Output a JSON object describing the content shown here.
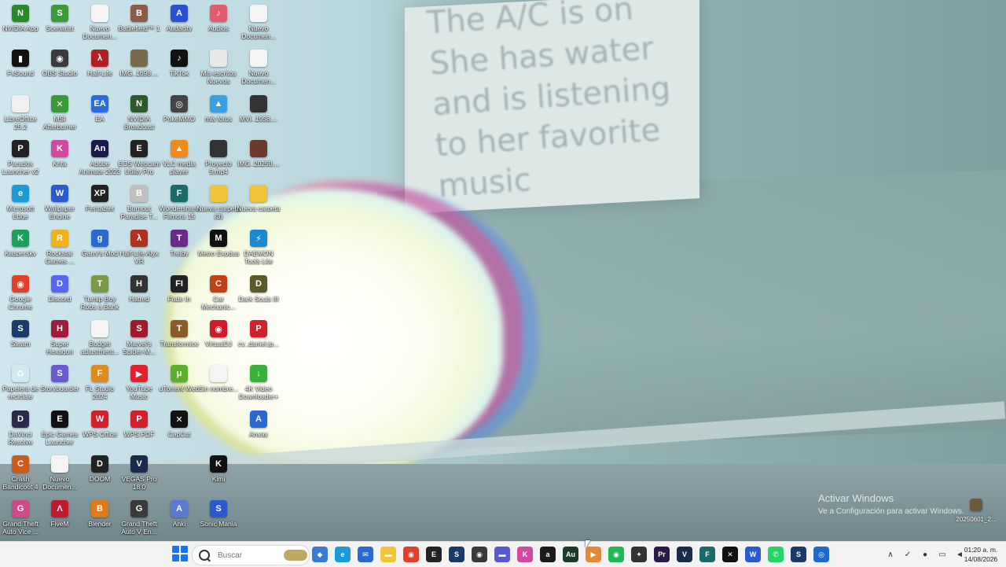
{
  "desktop": {
    "icons": [
      {
        "label": "NVIDIA App",
        "icon": "nvidia-icon",
        "color": "#2a8a2a",
        "glyph": "N"
      },
      {
        "label": "Scenarist",
        "icon": "scenarist-icon",
        "color": "#3c9a3c",
        "glyph": "S"
      },
      {
        "label": "Nuevo Documen...",
        "icon": "document-icon",
        "color": "#f4f4f4",
        "glyph": ""
      },
      {
        "label": "Battlefield™ 1",
        "icon": "battlefield-icon",
        "color": "#8a5a4a",
        "glyph": "B"
      },
      {
        "label": "Audacity",
        "icon": "audacity-icon",
        "color": "#2b4fd1",
        "glyph": "A"
      },
      {
        "label": "Audios",
        "icon": "music-icon",
        "color": "#e25c6f",
        "glyph": "♪"
      },
      {
        "label": "Nuevo Documen...",
        "icon": "document-icon",
        "color": "#f4f4f4",
        "glyph": ""
      },
      {
        "label": "FxSound",
        "icon": "fxsound-icon",
        "color": "#111111",
        "glyph": "▮"
      },
      {
        "label": "OBS Studio",
        "icon": "obs-icon",
        "color": "#3a3a3a",
        "glyph": "◉"
      },
      {
        "label": "Half-Life",
        "icon": "half-life-icon",
        "color": "#b02020",
        "glyph": "λ"
      },
      {
        "label": "IMG_1698....",
        "icon": "image-icon",
        "color": "#7a6a4a",
        "glyph": ""
      },
      {
        "label": "TikTok",
        "icon": "tiktok-icon",
        "color": "#111111",
        "glyph": "♪"
      },
      {
        "label": "Mis escritos Nuevos",
        "icon": "documents-icon",
        "color": "#e8e8e8",
        "glyph": ""
      },
      {
        "label": "Nuevo Documen...",
        "icon": "document-icon",
        "color": "#f4f4f4",
        "glyph": ""
      },
      {
        "label": "LibreOffice 25.2",
        "icon": "libreoffice-icon",
        "color": "#f0f0f0",
        "glyph": ""
      },
      {
        "label": "MSI Afterburner",
        "icon": "msi-icon",
        "color": "#3a9a3a",
        "glyph": "✕"
      },
      {
        "label": "EA",
        "icon": "ea-icon",
        "color": "#2b6be0",
        "glyph": "EA"
      },
      {
        "label": "NVIDIA Broadcast",
        "icon": "nvidia-broadcast-icon",
        "color": "#2a5a2a",
        "glyph": "N"
      },
      {
        "label": "PokeMMO",
        "icon": "pokemmo-icon",
        "color": "#444444",
        "glyph": "◎"
      },
      {
        "label": "mis fotos",
        "icon": "photos-icon",
        "color": "#3aa0e0",
        "glyph": "▲"
      },
      {
        "label": "MVI_1958....",
        "icon": "video-icon",
        "color": "#333333",
        "glyph": ""
      },
      {
        "label": "Paradox Launcher v2",
        "icon": "paradox-icon",
        "color": "#222222",
        "glyph": "P"
      },
      {
        "label": "Krita",
        "icon": "krita-icon",
        "color": "#d04aa0",
        "glyph": "K"
      },
      {
        "label": "Adobe Animate 2023",
        "icon": "animate-icon",
        "color": "#1a1a4a",
        "glyph": "An"
      },
      {
        "label": "EOS Webcam Utility Pro",
        "icon": "eos-icon",
        "color": "#222222",
        "glyph": "E"
      },
      {
        "label": "VLC media player",
        "icon": "vlc-icon",
        "color": "#f08a1a",
        "glyph": "▲"
      },
      {
        "label": "Proyecto 9.mp4",
        "icon": "video-icon",
        "color": "#333333",
        "glyph": ""
      },
      {
        "label": "IMG_20250....",
        "icon": "image-icon",
        "color": "#6a3a2a",
        "glyph": ""
      },
      {
        "label": "Microsoft Edge",
        "icon": "edge-icon",
        "color": "#1a9ad6",
        "glyph": "e"
      },
      {
        "label": "Wallpaper Engine",
        "icon": "wallpaper-engine-icon",
        "color": "#2a5ad0",
        "glyph": "W"
      },
      {
        "label": "Pentablet",
        "icon": "pentablet-icon",
        "color": "#222222",
        "glyph": "XP"
      },
      {
        "label": "Burnout Paradise T...",
        "icon": "burnout-icon",
        "color": "#c0c0c0",
        "glyph": "B"
      },
      {
        "label": "Wondershare Filmora 15",
        "icon": "filmora-icon",
        "color": "#1a6a6a",
        "glyph": "F"
      },
      {
        "label": "Nueva carpeta (3)",
        "icon": "folder-icon",
        "color": "#f2c43a",
        "glyph": ""
      },
      {
        "label": "Nueva carpeta",
        "icon": "folder-icon",
        "color": "#f2c43a",
        "glyph": ""
      },
      {
        "label": "Kaspersky",
        "icon": "kaspersky-icon",
        "color": "#1aa05a",
        "glyph": "K"
      },
      {
        "label": "Rockstar Games ...",
        "icon": "rockstar-icon",
        "color": "#f2b01a",
        "glyph": "R"
      },
      {
        "label": "Garry's Mod",
        "icon": "garrys-mod-icon",
        "color": "#2a6ad0",
        "glyph": "g"
      },
      {
        "label": "Half-Life Alyx VR",
        "icon": "alyx-icon",
        "color": "#b03020",
        "glyph": "λ"
      },
      {
        "label": "Trelby",
        "icon": "trelby-icon",
        "color": "#6a2a8a",
        "glyph": "T"
      },
      {
        "label": "Metro Exodus",
        "icon": "metro-icon",
        "color": "#111111",
        "glyph": "M"
      },
      {
        "label": "DAEMON Tools Lite",
        "icon": "daemon-tools-icon",
        "color": "#1a8ad0",
        "glyph": "⚡"
      },
      {
        "label": "Google Chrome",
        "icon": "chrome-icon",
        "color": "#e0402a",
        "glyph": "◉"
      },
      {
        "label": "Discord",
        "icon": "discord-icon",
        "color": "#5865f2",
        "glyph": "D"
      },
      {
        "label": "Turnip Boy Robs a Bank",
        "icon": "turnip-icon",
        "color": "#7a9a4a",
        "glyph": "T"
      },
      {
        "label": "Hatred",
        "icon": "hatred-icon",
        "color": "#333333",
        "glyph": "H"
      },
      {
        "label": "Fade In",
        "icon": "fadein-icon",
        "color": "#222222",
        "glyph": "FI"
      },
      {
        "label": "Car Mechanic...",
        "icon": "car-mechanic-icon",
        "color": "#c0401a",
        "glyph": "C"
      },
      {
        "label": "Dark Souls III",
        "icon": "dark-souls-icon",
        "color": "#5a5a2a",
        "glyph": "D"
      },
      {
        "label": "Steam",
        "icon": "steam-icon",
        "color": "#1a3a6a",
        "glyph": "S"
      },
      {
        "label": "Super Hexagon",
        "icon": "super-hexagon-icon",
        "color": "#a01a3a",
        "glyph": "H"
      },
      {
        "label": "Budget adjustment...",
        "icon": "document-icon",
        "color": "#f4f4f4",
        "glyph": ""
      },
      {
        "label": "Marvel's Spider-M...",
        "icon": "spiderman-icon",
        "color": "#a01a2a",
        "glyph": "S"
      },
      {
        "label": "Transformice",
        "icon": "transformice-icon",
        "color": "#8a5a2a",
        "glyph": "T"
      },
      {
        "label": "VirtualDJ",
        "icon": "virtualdj-icon",
        "color": "#d01a2a",
        "glyph": "◉"
      },
      {
        "label": "cv_daniel.jp...",
        "icon": "wps-pdf-icon",
        "color": "#d0202a",
        "glyph": "P"
      },
      {
        "label": "Papelera de reciclaje",
        "icon": "recycle-bin-icon",
        "color": "#d0e8f0",
        "glyph": "♻"
      },
      {
        "label": "Storyboarder",
        "icon": "storyboarder-icon",
        "color": "#6a5ad0",
        "glyph": "S"
      },
      {
        "label": "FL Studio 2024",
        "icon": "fl-studio-icon",
        "color": "#e08a1a",
        "glyph": "F"
      },
      {
        "label": "YouTube Music",
        "icon": "youtube-music-icon",
        "color": "#e0202a",
        "glyph": "▶"
      },
      {
        "label": "uTorrent Web",
        "icon": "utorrent-icon",
        "color": "#5ab02a",
        "glyph": "μ"
      },
      {
        "label": "Sin nombre...",
        "icon": "document-icon",
        "color": "#f4f4f4",
        "glyph": ""
      },
      {
        "label": "4K Video Downloader+",
        "icon": "4k-video-icon",
        "color": "#3ab03a",
        "glyph": "↓"
      },
      {
        "label": "DaVinci Resolve",
        "icon": "davinci-icon",
        "color": "#2a2a4a",
        "glyph": "D"
      },
      {
        "label": "Epic Games Launcher",
        "icon": "epic-games-icon",
        "color": "#111111",
        "glyph": "E"
      },
      {
        "label": "WPS Office",
        "icon": "wps-office-icon",
        "color": "#d0202a",
        "glyph": "W"
      },
      {
        "label": "WPS PDF",
        "icon": "wps-pdf-icon",
        "color": "#d0202a",
        "glyph": "P"
      },
      {
        "label": "CapCut",
        "icon": "capcut-icon",
        "color": "#111111",
        "glyph": "✕"
      },
      {
        "label": "",
        "icon": "",
        "color": "",
        "glyph": ""
      },
      {
        "label": "Anvay",
        "icon": "anvay-icon",
        "color": "#2a6ad0",
        "glyph": "A"
      },
      {
        "label": "Crash Bandicoot 4",
        "icon": "crash-icon",
        "color": "#d05a1a",
        "glyph": "C"
      },
      {
        "label": "Nuevo Documen...",
        "icon": "document-icon",
        "color": "#f4f4f4",
        "glyph": ""
      },
      {
        "label": "DOOM",
        "icon": "doom-icon",
        "color": "#222222",
        "glyph": "D"
      },
      {
        "label": "VEGAS Pro 18.0",
        "icon": "vegas-icon",
        "color": "#1a2a4a",
        "glyph": "V"
      },
      {
        "label": "",
        "icon": "",
        "color": "",
        "glyph": ""
      },
      {
        "label": "Kimi",
        "icon": "kimi-icon",
        "color": "#111111",
        "glyph": "K"
      },
      {
        "label": "",
        "icon": "",
        "color": "",
        "glyph": ""
      },
      {
        "label": "Grand Theft Auto Vice ...",
        "icon": "gta-vice-icon",
        "color": "#d04a8a",
        "glyph": "G"
      },
      {
        "label": "FiveM",
        "icon": "fivem-icon",
        "color": "#c01a2a",
        "glyph": "Λ"
      },
      {
        "label": "Blender",
        "icon": "blender-icon",
        "color": "#e07a1a",
        "glyph": "B"
      },
      {
        "label": "Grand Theft Auto V En...",
        "icon": "gta-v-icon",
        "color": "#3a3a3a",
        "glyph": "G"
      },
      {
        "label": "Anki",
        "icon": "anki-icon",
        "color": "#5a7ad0",
        "glyph": "A"
      },
      {
        "label": "Sonic Mania",
        "icon": "sonic-icon",
        "color": "#2a5ad0",
        "glyph": "S"
      },
      {
        "label": "",
        "icon": "",
        "color": "",
        "glyph": ""
      }
    ],
    "wallpaper_sign_text": "The A/C is on\nShe has water\nand is listening\nto her favorite\nmusic",
    "watermark": {
      "line1": "Activar Windows",
      "line2": "Ve a Configuración para activar Windows."
    },
    "corner_file": {
      "label": "20250601_2...",
      "icon": "image-icon"
    }
  },
  "taskbar": {
    "search_placeholder": "Buscar",
    "apps": [
      {
        "icon": "copilot-icon",
        "color": "#3a7ad0",
        "glyph": "◆"
      },
      {
        "icon": "edge-icon",
        "color": "#1a9ad6",
        "glyph": "e"
      },
      {
        "icon": "mail-icon",
        "color": "#2a6ad0",
        "glyph": "✉"
      },
      {
        "icon": "file-explorer-icon",
        "color": "#f2c43a",
        "glyph": "▬"
      },
      {
        "icon": "chrome-icon",
        "color": "#e0402a",
        "glyph": "◉"
      },
      {
        "icon": "epic-games-icon",
        "color": "#222222",
        "glyph": "E"
      },
      {
        "icon": "steam-icon",
        "color": "#1a3a6a",
        "glyph": "S"
      },
      {
        "icon": "obs-icon",
        "color": "#3a3a3a",
        "glyph": "◉"
      },
      {
        "icon": "capcut-icon",
        "color": "#5a5ad0",
        "glyph": "▬"
      },
      {
        "icon": "krita-icon",
        "color": "#d04aa0",
        "glyph": "K"
      },
      {
        "icon": "alight-icon",
        "color": "#1a1a1a",
        "glyph": "a"
      },
      {
        "icon": "audition-icon",
        "color": "#1a3a2a",
        "glyph": "Au"
      },
      {
        "icon": "media-player-icon",
        "color": "#e08a3a",
        "glyph": "▶"
      },
      {
        "icon": "spotify-icon",
        "color": "#1db954",
        "glyph": "◉"
      },
      {
        "icon": "pentablet-icon",
        "color": "#333333",
        "glyph": "✦"
      },
      {
        "icon": "premiere-icon",
        "color": "#2a1a4a",
        "glyph": "Pr"
      },
      {
        "icon": "vegas-icon",
        "color": "#1a2a4a",
        "glyph": "V"
      },
      {
        "icon": "filmora-icon",
        "color": "#1a6a6a",
        "glyph": "F"
      },
      {
        "icon": "capcut-icon",
        "color": "#111111",
        "glyph": "✕"
      },
      {
        "icon": "wallpaper-engine-icon",
        "color": "#2a5ad0",
        "glyph": "W"
      },
      {
        "icon": "whatsapp-icon",
        "color": "#25d366",
        "glyph": "✆"
      },
      {
        "icon": "steam-icon",
        "color": "#1a3a6a",
        "glyph": "S"
      },
      {
        "icon": "globe-icon",
        "color": "#1a6ad0",
        "glyph": "◎"
      }
    ],
    "tray": [
      {
        "icon": "chevron-up-icon",
        "glyph": "∧"
      },
      {
        "icon": "antivirus-icon",
        "glyph": "✓"
      },
      {
        "icon": "microphone-icon",
        "glyph": "●"
      },
      {
        "icon": "cast-icon",
        "glyph": "▭"
      },
      {
        "icon": "volume-icon",
        "glyph": "◄"
      }
    ],
    "clock": {
      "time": "01:20 a. m.",
      "date": "14/08/2026"
    }
  }
}
